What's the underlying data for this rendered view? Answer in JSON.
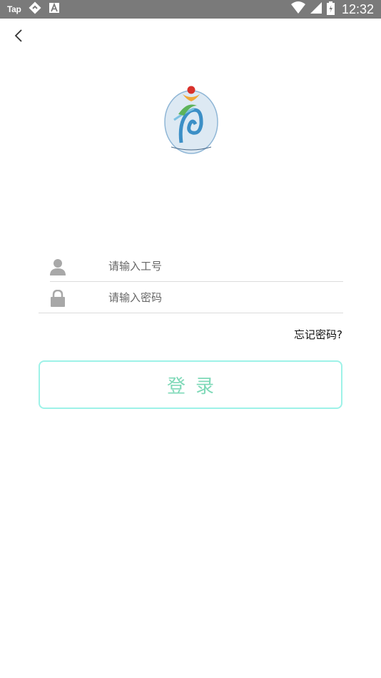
{
  "status_bar": {
    "left_label": "Tap",
    "icons": [
      "nav-diamond-icon",
      "a-box-icon",
      "wifi-icon",
      "signal-icon",
      "battery-icon"
    ],
    "time": "12:32",
    "background": "#7a7a7a"
  },
  "nav": {
    "back_icon": "chevron-left-icon"
  },
  "logo": {
    "name": "organization-logo"
  },
  "form": {
    "username_placeholder": "请输入工号",
    "password_placeholder": "请输入密码",
    "username_icon": "person-icon",
    "password_icon": "lock-icon",
    "forgot_label": "忘记密码?",
    "login_label": "登录"
  },
  "colors": {
    "button_border": "#9ef2e8",
    "button_text": "#7fd9b8",
    "icon_gray": "#a8a8a8"
  }
}
